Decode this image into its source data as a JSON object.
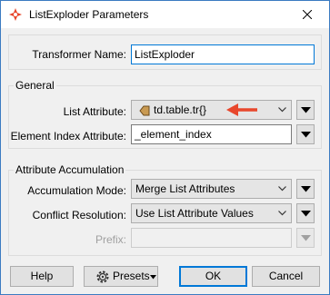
{
  "window": {
    "title": "ListExploder Parameters",
    "close_icon": "close-icon"
  },
  "fields": {
    "transformer_name": {
      "label": "Transformer Name:",
      "value": "ListExploder"
    }
  },
  "general": {
    "title": "General",
    "list_attribute": {
      "label": "List Attribute:",
      "value": "td.table.tr{}"
    },
    "element_index": {
      "label": "Element Index Attribute:",
      "value": "_element_index"
    }
  },
  "accumulation": {
    "title": "Attribute Accumulation",
    "mode": {
      "label": "Accumulation Mode:",
      "value": "Merge List Attributes"
    },
    "conflict": {
      "label": "Conflict Resolution:",
      "value": "Use List Attribute Values"
    },
    "prefix": {
      "label": "Prefix:",
      "value": ""
    }
  },
  "buttons": {
    "help": "Help",
    "presets": "Presets",
    "ok": "OK",
    "cancel": "Cancel"
  },
  "colors": {
    "accent": "#0078d7",
    "annotation_arrow": "#e8472c",
    "app_icon": "#e8472c"
  }
}
